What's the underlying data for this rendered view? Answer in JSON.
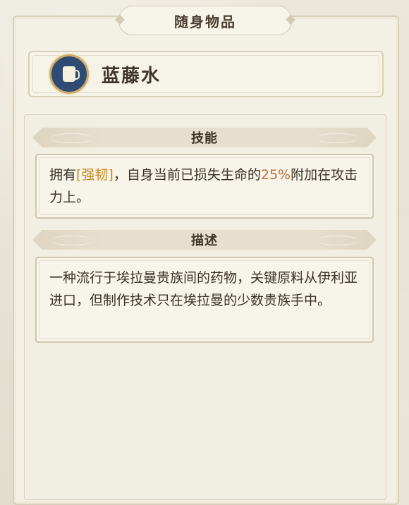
{
  "header": {
    "title": "随身物品"
  },
  "item": {
    "name": "蓝藤水",
    "icon": "cup-icon"
  },
  "skill": {
    "label": "技能",
    "text_before": "拥有",
    "keyword": "[强韧]",
    "text_middle": "，自身当前已损失生命的",
    "value": "25%",
    "text_after": "附加在攻击力上。"
  },
  "description": {
    "label": "描述",
    "text": "一种流行于埃拉曼贵族间的药物，关键原料从伊利亚进口，但制作技术只在埃拉曼的少数贵族手中。"
  },
  "colors": {
    "keyword": "#c98a1e",
    "value": "#c56a3a",
    "icon_bg": "#2f4a73",
    "icon_ring": "#c9a968"
  }
}
